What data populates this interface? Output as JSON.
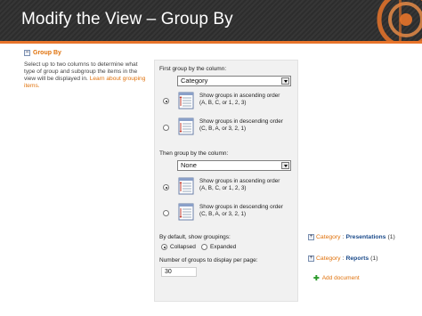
{
  "slide": {
    "title": "Modify the View – Group By"
  },
  "group_by": {
    "heading": "Group By",
    "description": "Select up to two columns to determine what type of group and subgroup the items in the view will be displayed in.",
    "learn_more_link": "Learn about grouping items.",
    "first_group": {
      "label": "First group by the column:",
      "selected": "Category",
      "ascending_label_1": "Show groups in ascending order",
      "ascending_label_2": "(A, B, C, or 1, 2, 3)",
      "descending_label_1": "Show groups in descending order",
      "descending_label_2": "(C, B, A, or 3, 2, 1)",
      "ascending_selected": true
    },
    "then_group": {
      "label": "Then group by the column:",
      "selected": "None",
      "ascending_label_1": "Show groups in ascending order",
      "ascending_label_2": "(A, B, C, or 1, 2, 3)",
      "descending_label_1": "Show groups in descending order",
      "descending_label_2": "(C, B, A, or 3, 2, 1)",
      "ascending_selected": true
    },
    "default_show": {
      "label": "By default, show groupings:",
      "collapsed_label": "Collapsed",
      "expanded_label": "Expanded",
      "collapsed_selected": true
    },
    "groups_per_page": {
      "label": "Number of groups to display per page:",
      "value": "30"
    }
  },
  "preview": {
    "groups": [
      {
        "category_label": "Category",
        "separator": ":",
        "value": "Presentations",
        "count": "(1)"
      },
      {
        "category_label": "Category",
        "separator": ":",
        "value": "Reports",
        "count": "(1)"
      }
    ],
    "add_document": "Add document"
  },
  "colors": {
    "title_bar": "#2f2f2f",
    "accent_orange": "#e8742a",
    "link_orange": "#e0720c",
    "group_value_blue": "#1a4a8a"
  }
}
